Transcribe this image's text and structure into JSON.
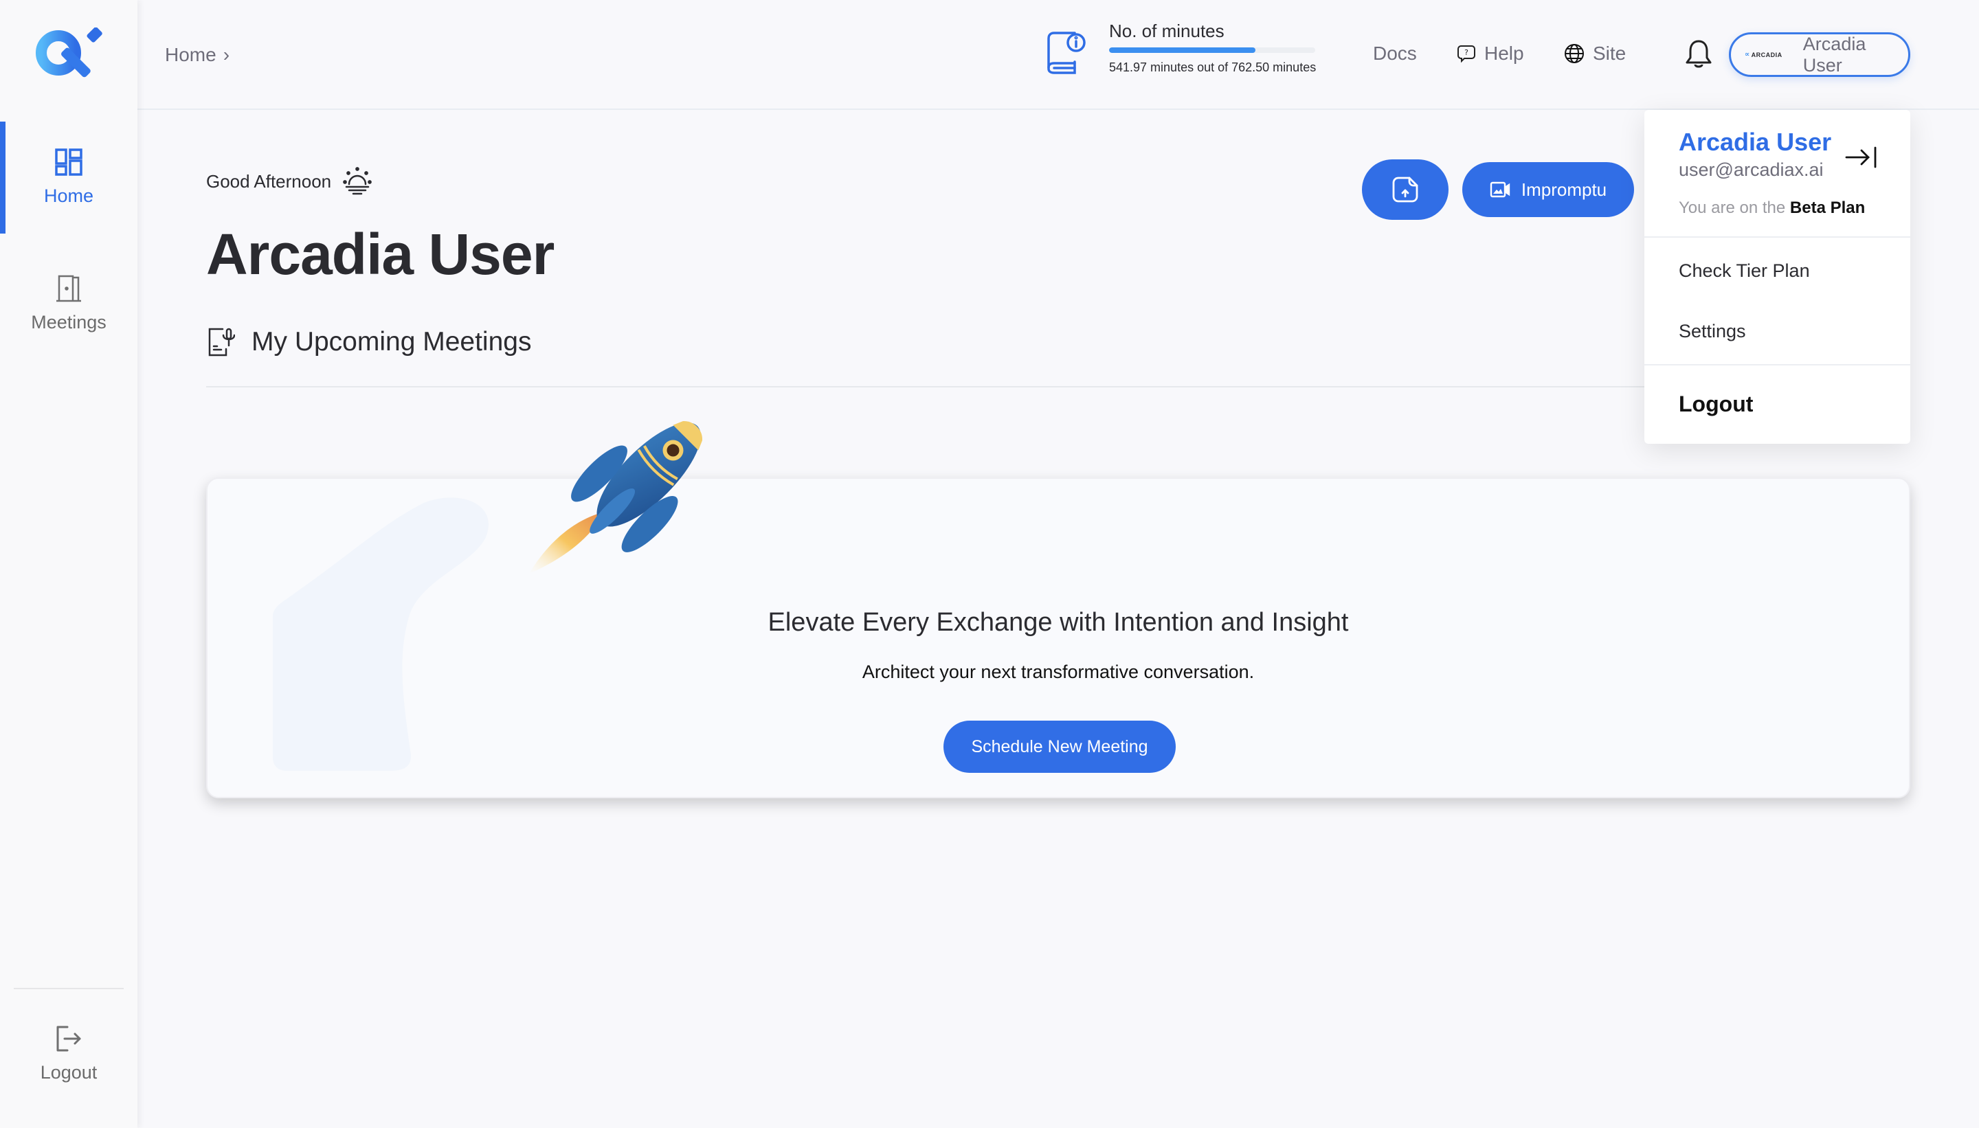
{
  "sidebar": {
    "items": [
      {
        "label": "Home",
        "icon": "dashboard-grid-icon",
        "active": true
      },
      {
        "label": "Meetings",
        "icon": "door-icon",
        "active": false
      }
    ],
    "logout_label": "Logout"
  },
  "header": {
    "breadcrumb": {
      "label": "Home",
      "separator": "›"
    },
    "minutes": {
      "title": "No. of minutes",
      "used": 541.97,
      "total": 762.5,
      "percent": 71.08,
      "text": "541.97 minutes out of 762.50 minutes"
    },
    "links": {
      "docs": "Docs",
      "help": "Help",
      "site": "Site"
    },
    "user_pill": {
      "logo_text": "ARCADIA",
      "name": "Arcadia User"
    }
  },
  "main": {
    "greeting": "Good Afternoon",
    "user_name": "Arcadia User",
    "section_title": "My Upcoming Meetings",
    "buttons": {
      "impromptu": "Impromptu"
    },
    "card": {
      "title": "Elevate Every Exchange with Intention and Insight",
      "subtitle": "Architect your next transformative conversation.",
      "cta": "Schedule New Meeting"
    }
  },
  "dropdown": {
    "name": "Arcadia User",
    "email": "user@arcadiax.ai",
    "plan_prefix": "You are on the",
    "plan_name": "Beta Plan",
    "items": {
      "check_tier": "Check Tier Plan",
      "settings": "Settings",
      "logout": "Logout"
    }
  },
  "colors": {
    "accent": "#316ee6",
    "progress": "#3b8ff0",
    "text": "#2b2b30",
    "muted": "#6e6d7a"
  }
}
